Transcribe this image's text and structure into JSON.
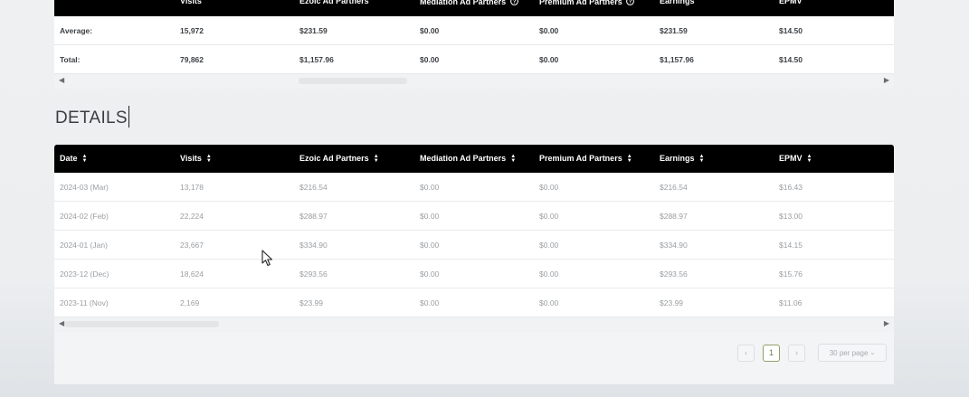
{
  "columns": [
    "Date",
    "Visits",
    "Ezoic Ad Partners",
    "Mediation Ad Partners",
    "Premium Ad Partners",
    "Earnings",
    "EPMV"
  ],
  "summary": {
    "rows": [
      [
        "Average:",
        "15,972",
        "$231.59",
        "$0.00",
        "$0.00",
        "$231.59",
        "$14.50"
      ],
      [
        "Total:",
        "79,862",
        "$1,157.96",
        "$0.00",
        "$0.00",
        "$1,157.96",
        "$14.50"
      ]
    ]
  },
  "details": {
    "title": "DETAILS",
    "rows": [
      [
        "2024-03 (Mar)",
        "13,178",
        "$216.54",
        "$0.00",
        "$0.00",
        "$216.54",
        "$16.43"
      ],
      [
        "2024-02 (Feb)",
        "22,224",
        "$288.97",
        "$0.00",
        "$0.00",
        "$288.97",
        "$13.00"
      ],
      [
        "2024-01 (Jan)",
        "23,667",
        "$334.90",
        "$0.00",
        "$0.00",
        "$334.90",
        "$14.15"
      ],
      [
        "2023-12 (Dec)",
        "18,624",
        "$293.56",
        "$0.00",
        "$0.00",
        "$293.56",
        "$15.76"
      ],
      [
        "2023-11 (Nov)",
        "2,169",
        "$23.99",
        "$0.00",
        "$0.00",
        "$23.99",
        "$11.06"
      ]
    ]
  },
  "pagination": {
    "prev": "‹",
    "current_page": "1",
    "next": "›",
    "per_page": "30 per page"
  },
  "icons": {
    "help": "help-circle-icon",
    "sort": "sort-icon",
    "scroll_left": "scroll-left-icon",
    "scroll_right": "scroll-right-icon",
    "cursor": "mouse-pointer-icon"
  }
}
